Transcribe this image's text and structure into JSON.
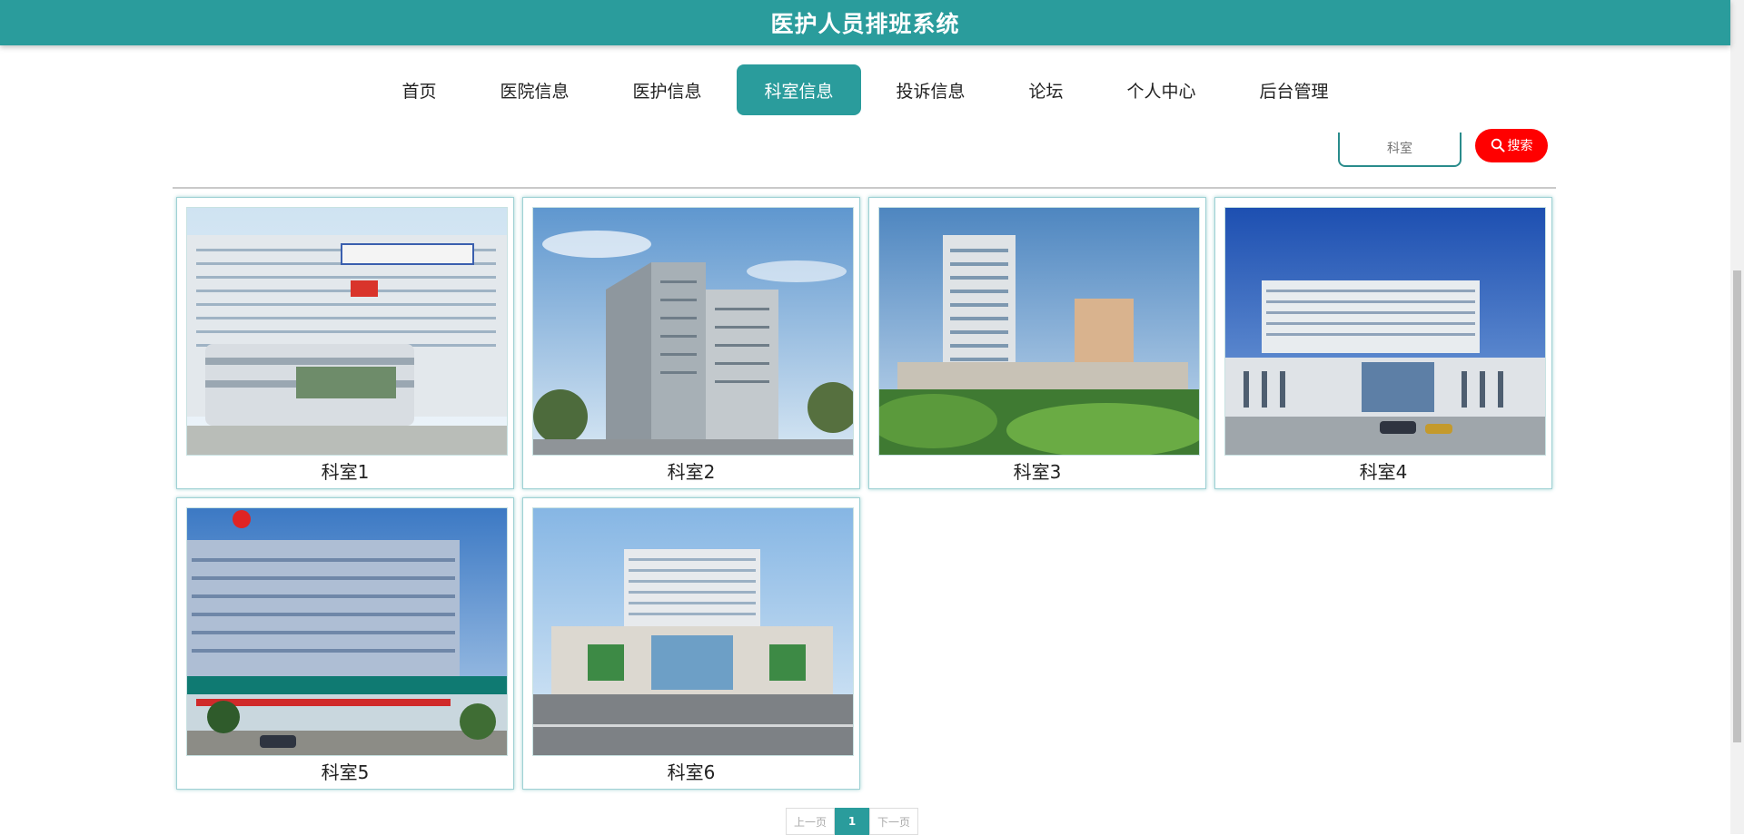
{
  "header": {
    "title": "医护人员排班系统"
  },
  "nav": [
    {
      "label": "首页",
      "active": false
    },
    {
      "label": "医院信息",
      "active": false
    },
    {
      "label": "医护信息",
      "active": false
    },
    {
      "label": "科室信息",
      "active": true
    },
    {
      "label": "投诉信息",
      "active": false
    },
    {
      "label": "论坛",
      "active": false
    },
    {
      "label": "个人中心",
      "active": false
    },
    {
      "label": "后台管理",
      "active": false
    }
  ],
  "search": {
    "placeholder": "科室",
    "button_label": "搜索",
    "icon": "search-icon"
  },
  "cards": [
    {
      "label": "科室1"
    },
    {
      "label": "科室2"
    },
    {
      "label": "科室3"
    },
    {
      "label": "科室4"
    },
    {
      "label": "科室5"
    },
    {
      "label": "科室6"
    }
  ],
  "pagination": {
    "prev": "上一页",
    "current": "1",
    "next": "下一页"
  },
  "colors": {
    "primary": "#2a9c9c",
    "search_button": "#ff0000"
  }
}
